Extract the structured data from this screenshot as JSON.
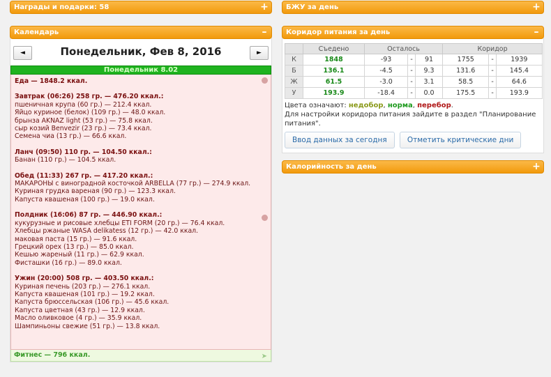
{
  "left": {
    "awards": {
      "title": "Награды и подарки: 58",
      "toggle": "+"
    },
    "calendar": {
      "title": "Календарь",
      "toggle": "–",
      "prev": "◄",
      "next": "►",
      "date": "Понедельник, Фев 8, 2016",
      "day_label": "Понедельник 8.02",
      "food_total": "Еда — 1848.2 ккал.",
      "meals": [
        {
          "title": "Завтрак (06:26) 258 гр. — 476.20 ккал.:",
          "items": [
            "пшеничная крупа (60 гр.) — 212.4 ккал.",
            "Яйцо куриное (белок) (109 гр.) — 48.0 ккал.",
            "брынза AKNAZ light (53 гр.) — 75.8 ккал.",
            "сыр козий Benvezir (23 гр.) — 73.4 ккал.",
            "Семена чиа (13 гр.) — 66.6 ккал."
          ]
        },
        {
          "title": "Ланч (09:50) 110 гр. — 104.50 ккал.:",
          "items": [
            "Банан (110 гр.) — 104.5 ккал."
          ]
        },
        {
          "title": "Обед (11:33) 267 гр. — 417.20 ккал.:",
          "items": [
            "МАКАРОНЫ с виноградной косточкой ARBELLA (77 гр.) — 274.9 ккал.",
            "Куриная грудка вареная (90 гр.) — 123.3 ккал.",
            "Капуста квашеная (100 гр.) — 19.0 ккал."
          ]
        },
        {
          "title": "Полдник (16:06) 87 гр. — 446.90 ккал.:",
          "items": [
            "кукурузные и рисовые хлебцы ETI FORM (20 гр.) — 76.4 ккал.",
            "Хлебцы ржаные WASA delikatess (12 гр.) — 42.0 ккал.",
            "маковая паста (15 гр.) — 91.6 ккал.",
            "Грецкий орех (13 гр.) — 85.0 ккал.",
            "Кешью жареный (11 гр.) — 62.9 ккал.",
            "Фисташки (16 гр.) — 89.0 ккал."
          ]
        },
        {
          "title": "Ужин (20:00) 508 гр. — 403.50 ккал.:",
          "items": [
            "Куриная печень (203 гр.) — 276.1 ккал.",
            "Капуста квашеная (101 гр.) — 19.2 ккал.",
            "Капуста брюссельская (106 гр.) — 45.6 ккал.",
            "Капуста цветная (43 гр.) — 12.9 ккал.",
            "Масло оливковое (4 гр.) — 35.9 ккал.",
            "Шампиньоны свежие (51 гр.) — 13.8 ккал."
          ]
        }
      ],
      "fitness": "Фитнес — 796 ккал."
    }
  },
  "right": {
    "bju": {
      "title": "БЖУ за день",
      "toggle": "+"
    },
    "corridor": {
      "title": "Коридор питания за день",
      "toggle": "–",
      "headers": [
        "",
        "Съедено",
        "Осталось",
        "Коридор"
      ],
      "rows": [
        {
          "label": "К",
          "eaten": "1848",
          "rem_min": "-93",
          "rem_sep": "-",
          "rem_max": "91",
          "cor_min": "1755",
          "cor_sep": "-",
          "cor_max": "1939"
        },
        {
          "label": "Б",
          "eaten": "136.1",
          "rem_min": "-4.5",
          "rem_sep": "-",
          "rem_max": "9.3",
          "cor_min": "131.6",
          "cor_sep": "-",
          "cor_max": "145.4"
        },
        {
          "label": "Ж",
          "eaten": "61.5",
          "rem_min": "-3.0",
          "rem_sep": "-",
          "rem_max": "3.1",
          "cor_min": "58.5",
          "cor_sep": "-",
          "cor_max": "64.6"
        },
        {
          "label": "У",
          "eaten": "193.9",
          "rem_min": "-18.4",
          "rem_sep": "-",
          "rem_max": "0.0",
          "cor_min": "175.5",
          "cor_sep": "-",
          "cor_max": "193.9"
        }
      ],
      "legend_prefix": "Цвета означают: ",
      "legend_under": "недобор",
      "legend_comma1": ", ",
      "legend_norm": "норма",
      "legend_comma2": ", ",
      "legend_over": "перебор",
      "legend_dot": ".",
      "note": "Для настройки коридора питания зайдите в раздел \"Планирование питания\".",
      "btn_enter": "Ввод данных за сегодня",
      "btn_critical": "Отметить критические дни"
    },
    "calorie": {
      "title": "Калорийность за день",
      "toggle": "+"
    }
  }
}
